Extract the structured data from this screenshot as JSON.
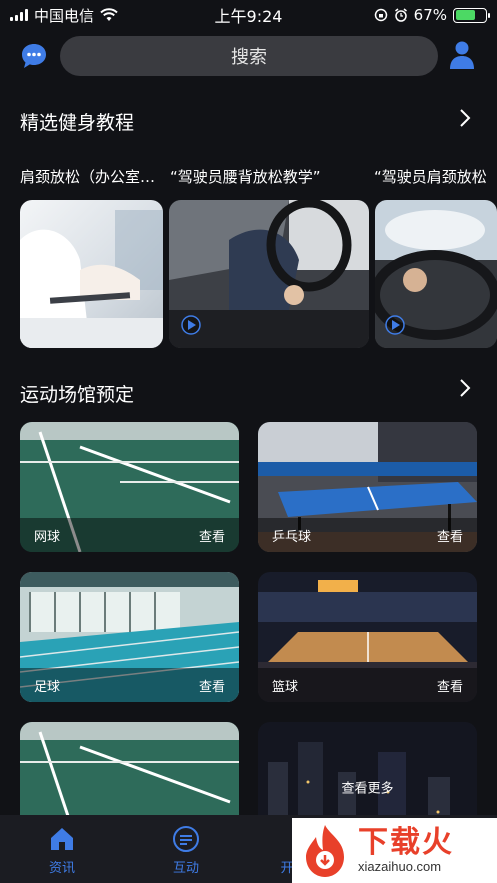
{
  "status_bar": {
    "carrier": "中国电信",
    "time": "上午9:24",
    "battery": "67%",
    "battery_level": 0.67
  },
  "header": {
    "search_label": "搜索"
  },
  "tutorials": {
    "title": "精选健身教程",
    "items": [
      {
        "label": "肩颈放松（办公室…"
      },
      {
        "label": "“驾驶员腰背放松教学”"
      },
      {
        "label": "“驾驶员肩颈放松"
      }
    ]
  },
  "venues": {
    "title": "运动场馆预定",
    "view_label": "查看",
    "items": [
      {
        "label": "网球"
      },
      {
        "label": "乒乓球"
      },
      {
        "label": "足球"
      },
      {
        "label": "篮球"
      }
    ],
    "more_label": "查看更多"
  },
  "tab_bar": {
    "tabs": [
      {
        "label": "资讯"
      },
      {
        "label": "互动"
      },
      {
        "label": "开"
      }
    ]
  },
  "watermark": {
    "big": "下载火",
    "small": "xiazaihuo.com"
  },
  "colors": {
    "accent": "#3f7ce6",
    "background": "#111216"
  }
}
